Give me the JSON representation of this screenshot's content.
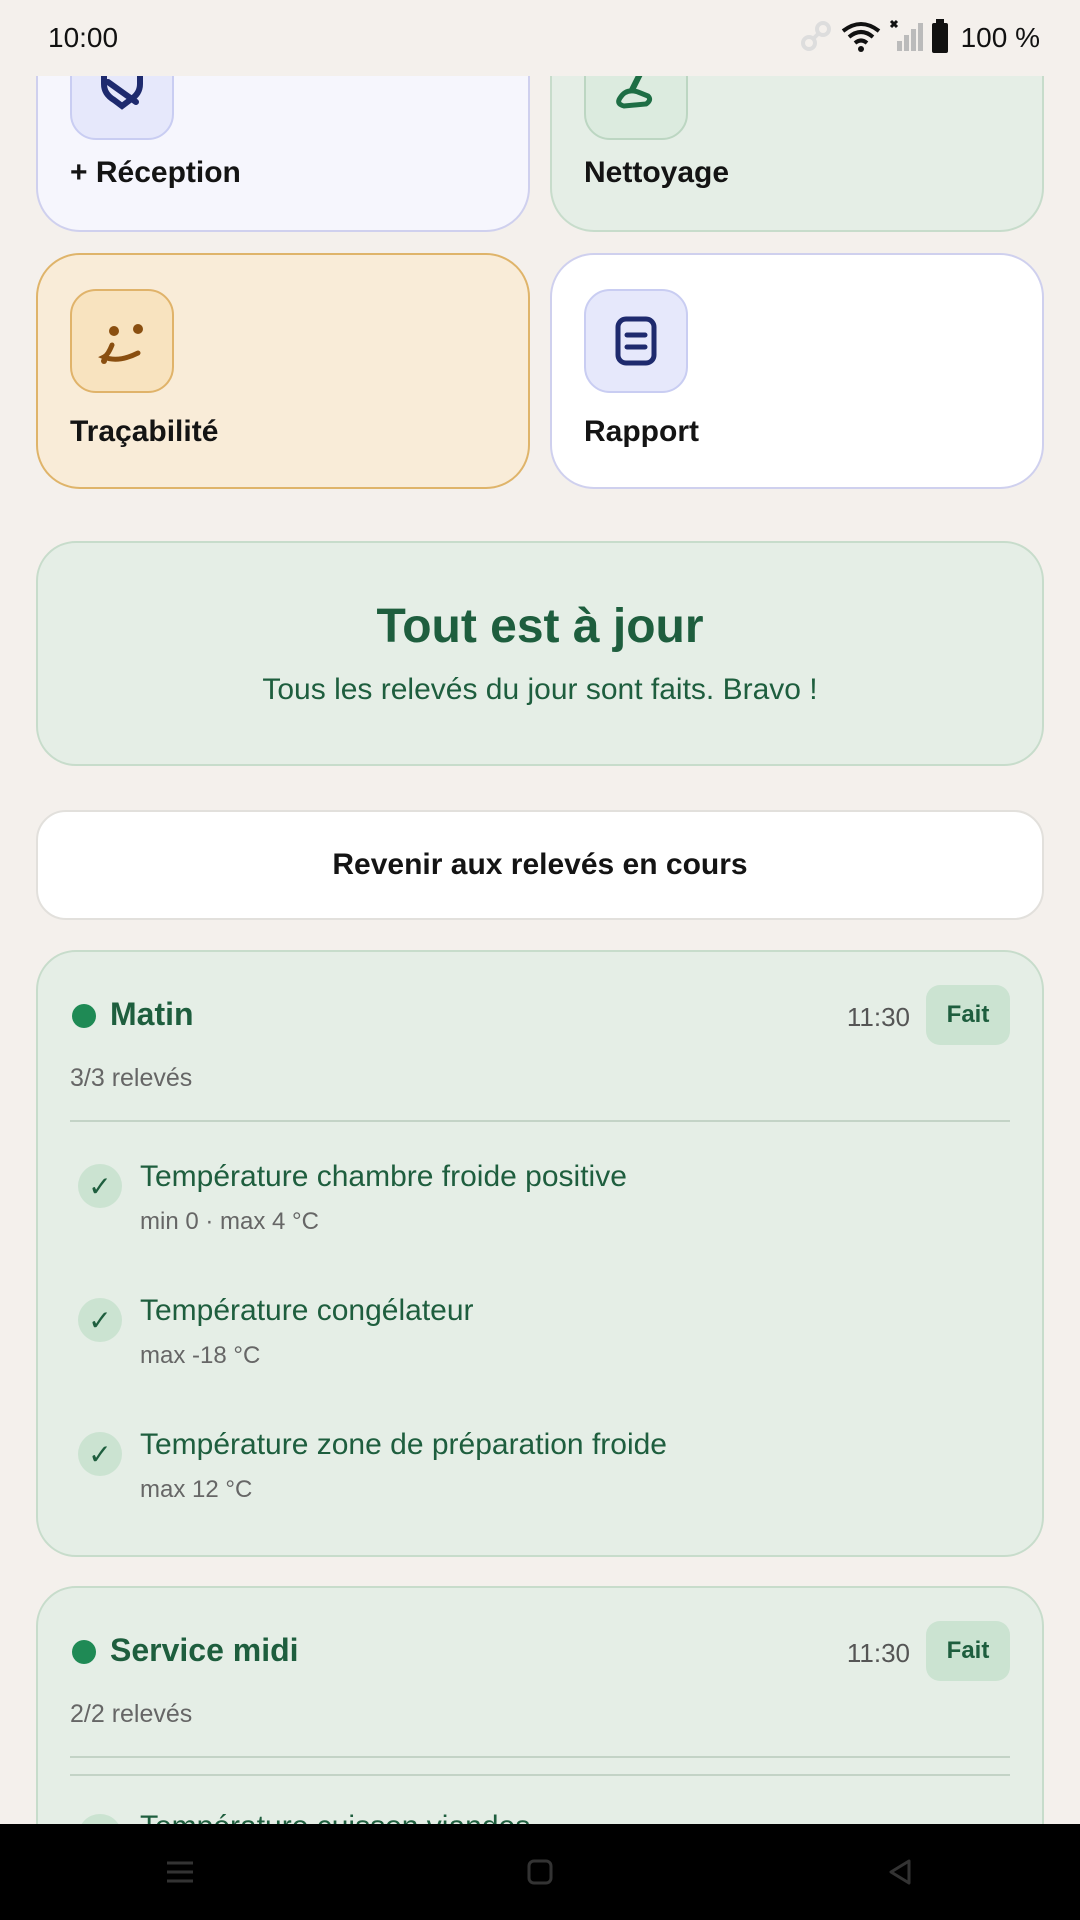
{
  "status_bar": {
    "time": "10:00",
    "battery": "100 %",
    "icons": [
      "data-saver-icon",
      "wifi-icon",
      "signal-icon",
      "battery-icon"
    ]
  },
  "tiles": [
    {
      "label": "+ Réception",
      "icon": "scan-icon"
    },
    {
      "label": "Nettoyage",
      "icon": "cleaning-icon"
    },
    {
      "label": "Traçabilité",
      "icon": "tag-icon"
    },
    {
      "label": "Rapport",
      "icon": "report-icon"
    }
  ],
  "status_card": {
    "title": "Tout est à jour",
    "subtitle": "Tous les relevés du jour sont faits. Bravo !"
  },
  "back_button": "Revenir aux relevés en cours",
  "sessions": [
    {
      "title": "Matin",
      "time": "11:30",
      "badge": "Fait",
      "count": "3/3 relevés",
      "items": [
        {
          "title": "Température chambre froide positive",
          "sub": "min 0 · max 4 °C"
        },
        {
          "title": "Température congélateur",
          "sub": "max -18 °C"
        },
        {
          "title": "Température zone de préparation froide",
          "sub": "max 12 °C"
        }
      ]
    },
    {
      "title": "Service midi",
      "time": "11:30",
      "badge": "Fait",
      "count": "2/2 relevés",
      "items": [
        {
          "title": "Température cuisson viandes",
          "sub": ""
        }
      ]
    }
  ],
  "check_glyph": "✓",
  "colors": {
    "background": "#f4f0ec",
    "green_text": "#1e5e3e",
    "green_dot": "#1f8a55",
    "green_card": "#e5eee6",
    "amber_card": "#f9ecd8",
    "indigo_card": "#f6f6fd"
  }
}
